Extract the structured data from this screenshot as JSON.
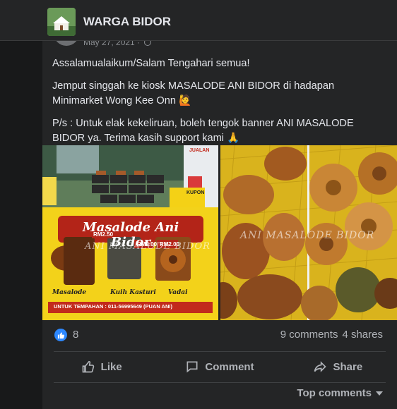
{
  "group": {
    "name": "WARGA BIDOR"
  },
  "post": {
    "date": "May 27, 2021 ·",
    "paragraphs": [
      "Assalamualaikum/Salam Tengahari semua!",
      "Jemput singgah ke kiosk MASALODE ANI BIDOR di hadapan Minimarket Wong Kee Onn 🙋",
      "P/s : Untuk elak kekeliruan, boleh tengok banner ANI MASALODE BIDOR ya. Terima kasih support kami 🙏"
    ],
    "photo_left": {
      "banner_title": "Masalode Ani Bidor",
      "watermark": "ANI MASALODE BIDOR",
      "prices": [
        "RM2.50",
        "RM2.00",
        "RM2.00"
      ],
      "items": [
        "Masalode",
        "Kuih Kasturi",
        "Vadai"
      ],
      "order_line": "UNTUK TEMPAHAN : 011-56995649 (PUAN ANI)",
      "sign": "JUALAN",
      "coupon": "KUPON"
    },
    "photo_right": {
      "watermark": "ANI MASALODE BIDOR"
    },
    "reactions": {
      "count": "8"
    },
    "comments_label": "9 comments",
    "shares_label": "4 shares",
    "actions": {
      "like": "Like",
      "comment": "Comment",
      "share": "Share"
    },
    "top_comments": "Top comments"
  },
  "colors": {
    "accent": "#2d88ff",
    "card": "#242526",
    "bg": "#18191a",
    "text": "#e4e6eb",
    "muted": "#b0b3b8",
    "banner_yellow": "#f3d21a"
  }
}
